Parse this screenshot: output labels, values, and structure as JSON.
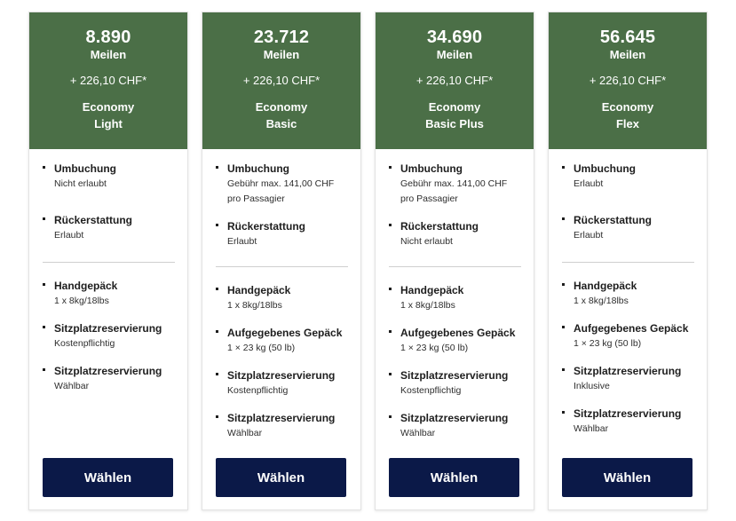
{
  "fares": [
    {
      "miles": "8.890",
      "miles_unit": "Meilen",
      "price": "+ 226,10 CHF*",
      "name_line1": "Economy",
      "name_line2": "Light",
      "group1": [
        {
          "title": "Umbuchung",
          "value": "Nicht erlaubt"
        },
        {
          "title": "Rückerstattung",
          "value": "Erlaubt"
        }
      ],
      "group2": [
        {
          "title": "Handgepäck",
          "value": "1 x 8kg/18lbs"
        },
        {
          "title": "Sitzplatzreservierung",
          "value": "Kostenpflichtig"
        },
        {
          "title": "Sitzplatzreservierung",
          "value": "Wählbar"
        }
      ],
      "button": "Wählen"
    },
    {
      "miles": "23.712",
      "miles_unit": "Meilen",
      "price": "+ 226,10 CHF*",
      "name_line1": "Economy",
      "name_line2": "Basic",
      "group1": [
        {
          "title": "Umbuchung",
          "value": "Gebühr max. 141,00 CHF pro Passagier"
        },
        {
          "title": "Rückerstattung",
          "value": "Erlaubt"
        }
      ],
      "group2": [
        {
          "title": "Handgepäck",
          "value": "1 x 8kg/18lbs"
        },
        {
          "title": "Aufgegebenes Gepäck",
          "value": "1 × 23 kg (50 lb)"
        },
        {
          "title": "Sitzplatzreservierung",
          "value": "Kostenpflichtig"
        },
        {
          "title": "Sitzplatzreservierung",
          "value": "Wählbar"
        }
      ],
      "button": "Wählen"
    },
    {
      "miles": "34.690",
      "miles_unit": "Meilen",
      "price": "+ 226,10 CHF*",
      "name_line1": "Economy",
      "name_line2": "Basic Plus",
      "group1": [
        {
          "title": "Umbuchung",
          "value": "Gebühr max. 141,00 CHF pro Passagier"
        },
        {
          "title": "Rückerstattung",
          "value": "Nicht erlaubt"
        }
      ],
      "group2": [
        {
          "title": "Handgepäck",
          "value": "1 x 8kg/18lbs"
        },
        {
          "title": "Aufgegebenes Gepäck",
          "value": "1 × 23 kg (50 lb)"
        },
        {
          "title": "Sitzplatzreservierung",
          "value": "Kostenpflichtig"
        },
        {
          "title": "Sitzplatzreservierung",
          "value": "Wählbar"
        }
      ],
      "button": "Wählen"
    },
    {
      "miles": "56.645",
      "miles_unit": "Meilen",
      "price": "+ 226,10 CHF*",
      "name_line1": "Economy",
      "name_line2": "Flex",
      "group1": [
        {
          "title": "Umbuchung",
          "value": "Erlaubt"
        },
        {
          "title": "Rückerstattung",
          "value": "Erlaubt"
        }
      ],
      "group2": [
        {
          "title": "Handgepäck",
          "value": "1 x 8kg/18lbs"
        },
        {
          "title": "Aufgegebenes Gepäck",
          "value": "1 × 23 kg (50 lb)"
        },
        {
          "title": "Sitzplatzreservierung",
          "value": "Inklusive"
        },
        {
          "title": "Sitzplatzreservierung",
          "value": "Wählbar"
        }
      ],
      "button": "Wählen"
    }
  ]
}
